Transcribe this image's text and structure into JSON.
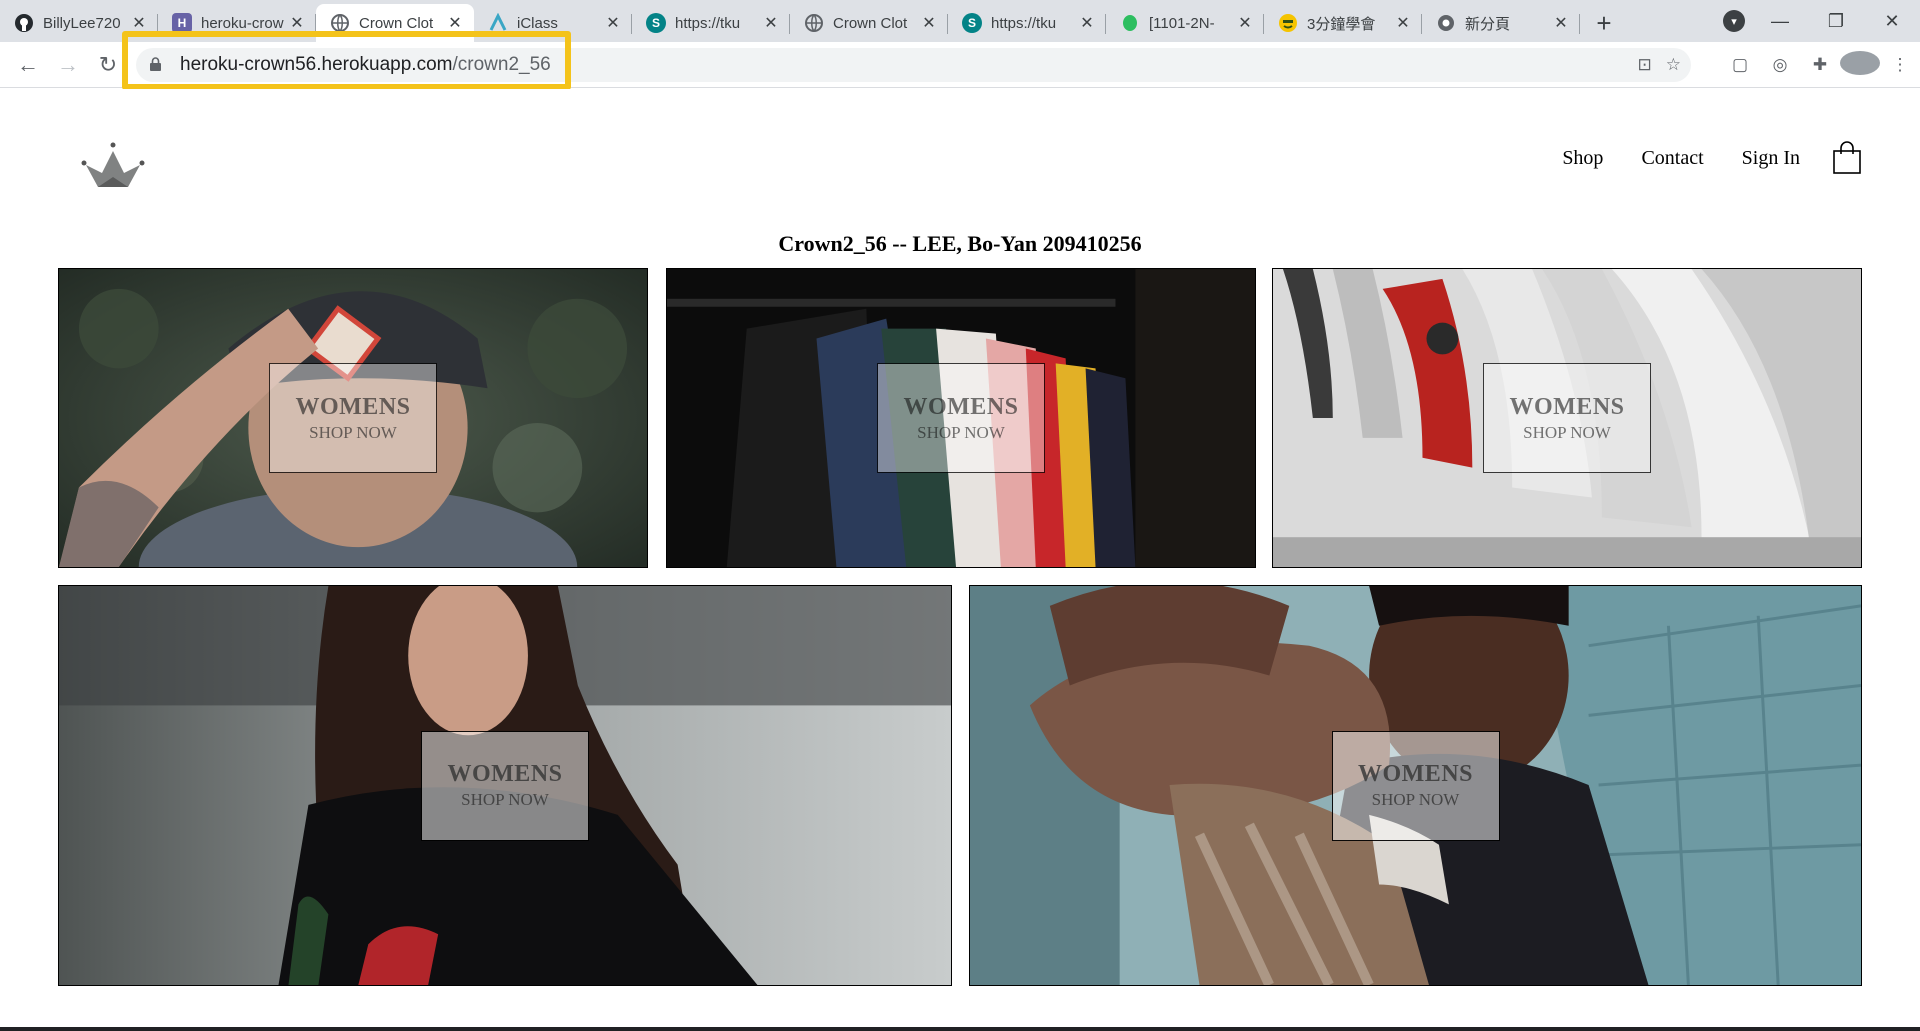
{
  "browser": {
    "tabs": [
      {
        "title": "BillyLee720",
        "icon": "github-icon",
        "color": "#24292e",
        "active": false
      },
      {
        "title": "heroku-crow",
        "icon": "heroku-icon",
        "color": "#6762a6",
        "active": false
      },
      {
        "title": "Crown Clot",
        "icon": "globe-icon",
        "color": "#5f6368",
        "active": true
      },
      {
        "title": "iClass",
        "icon": "iclass-icon",
        "color": "#3aa6c5",
        "active": false
      },
      {
        "title": "https://tku",
        "icon": "sharepoint-icon",
        "color": "#038387",
        "active": false
      },
      {
        "title": "Crown Clot",
        "icon": "globe-icon",
        "color": "#5f6368",
        "active": false
      },
      {
        "title": "https://tku",
        "icon": "sharepoint-icon",
        "color": "#038387",
        "active": false
      },
      {
        "title": "[1101-2N-",
        "icon": "evernote-icon",
        "color": "#2dbe60",
        "active": false
      },
      {
        "title": "3分鐘學會",
        "icon": "emoji-icon",
        "color": "#f5c400",
        "active": false
      },
      {
        "title": "新分頁",
        "icon": "chrome-icon",
        "color": "#5f6368",
        "active": false
      }
    ],
    "url_host": "heroku-crown56.herokuapp.com",
    "url_path": "/crown2_56",
    "highlight_color": "#f4c31a"
  },
  "site": {
    "nav": {
      "shop": "Shop",
      "contact": "Contact",
      "sign_in": "Sign In"
    },
    "page_title": "Crown2_56 -- LEE, Bo-Yan 209410256",
    "tiles": [
      {
        "title": "WOMENS",
        "subtitle": "SHOP NOW",
        "subject": "man in cap"
      },
      {
        "title": "WOMENS",
        "subtitle": "SHOP NOW",
        "subject": "clothing rack"
      },
      {
        "title": "WOMENS",
        "subtitle": "SHOP NOW",
        "subject": "sneakers"
      },
      {
        "title": "WOMENS",
        "subtitle": "SHOP NOW",
        "subject": "woman in black"
      },
      {
        "title": "WOMENS",
        "subtitle": "SHOP NOW",
        "subject": "man reaching"
      }
    ]
  }
}
